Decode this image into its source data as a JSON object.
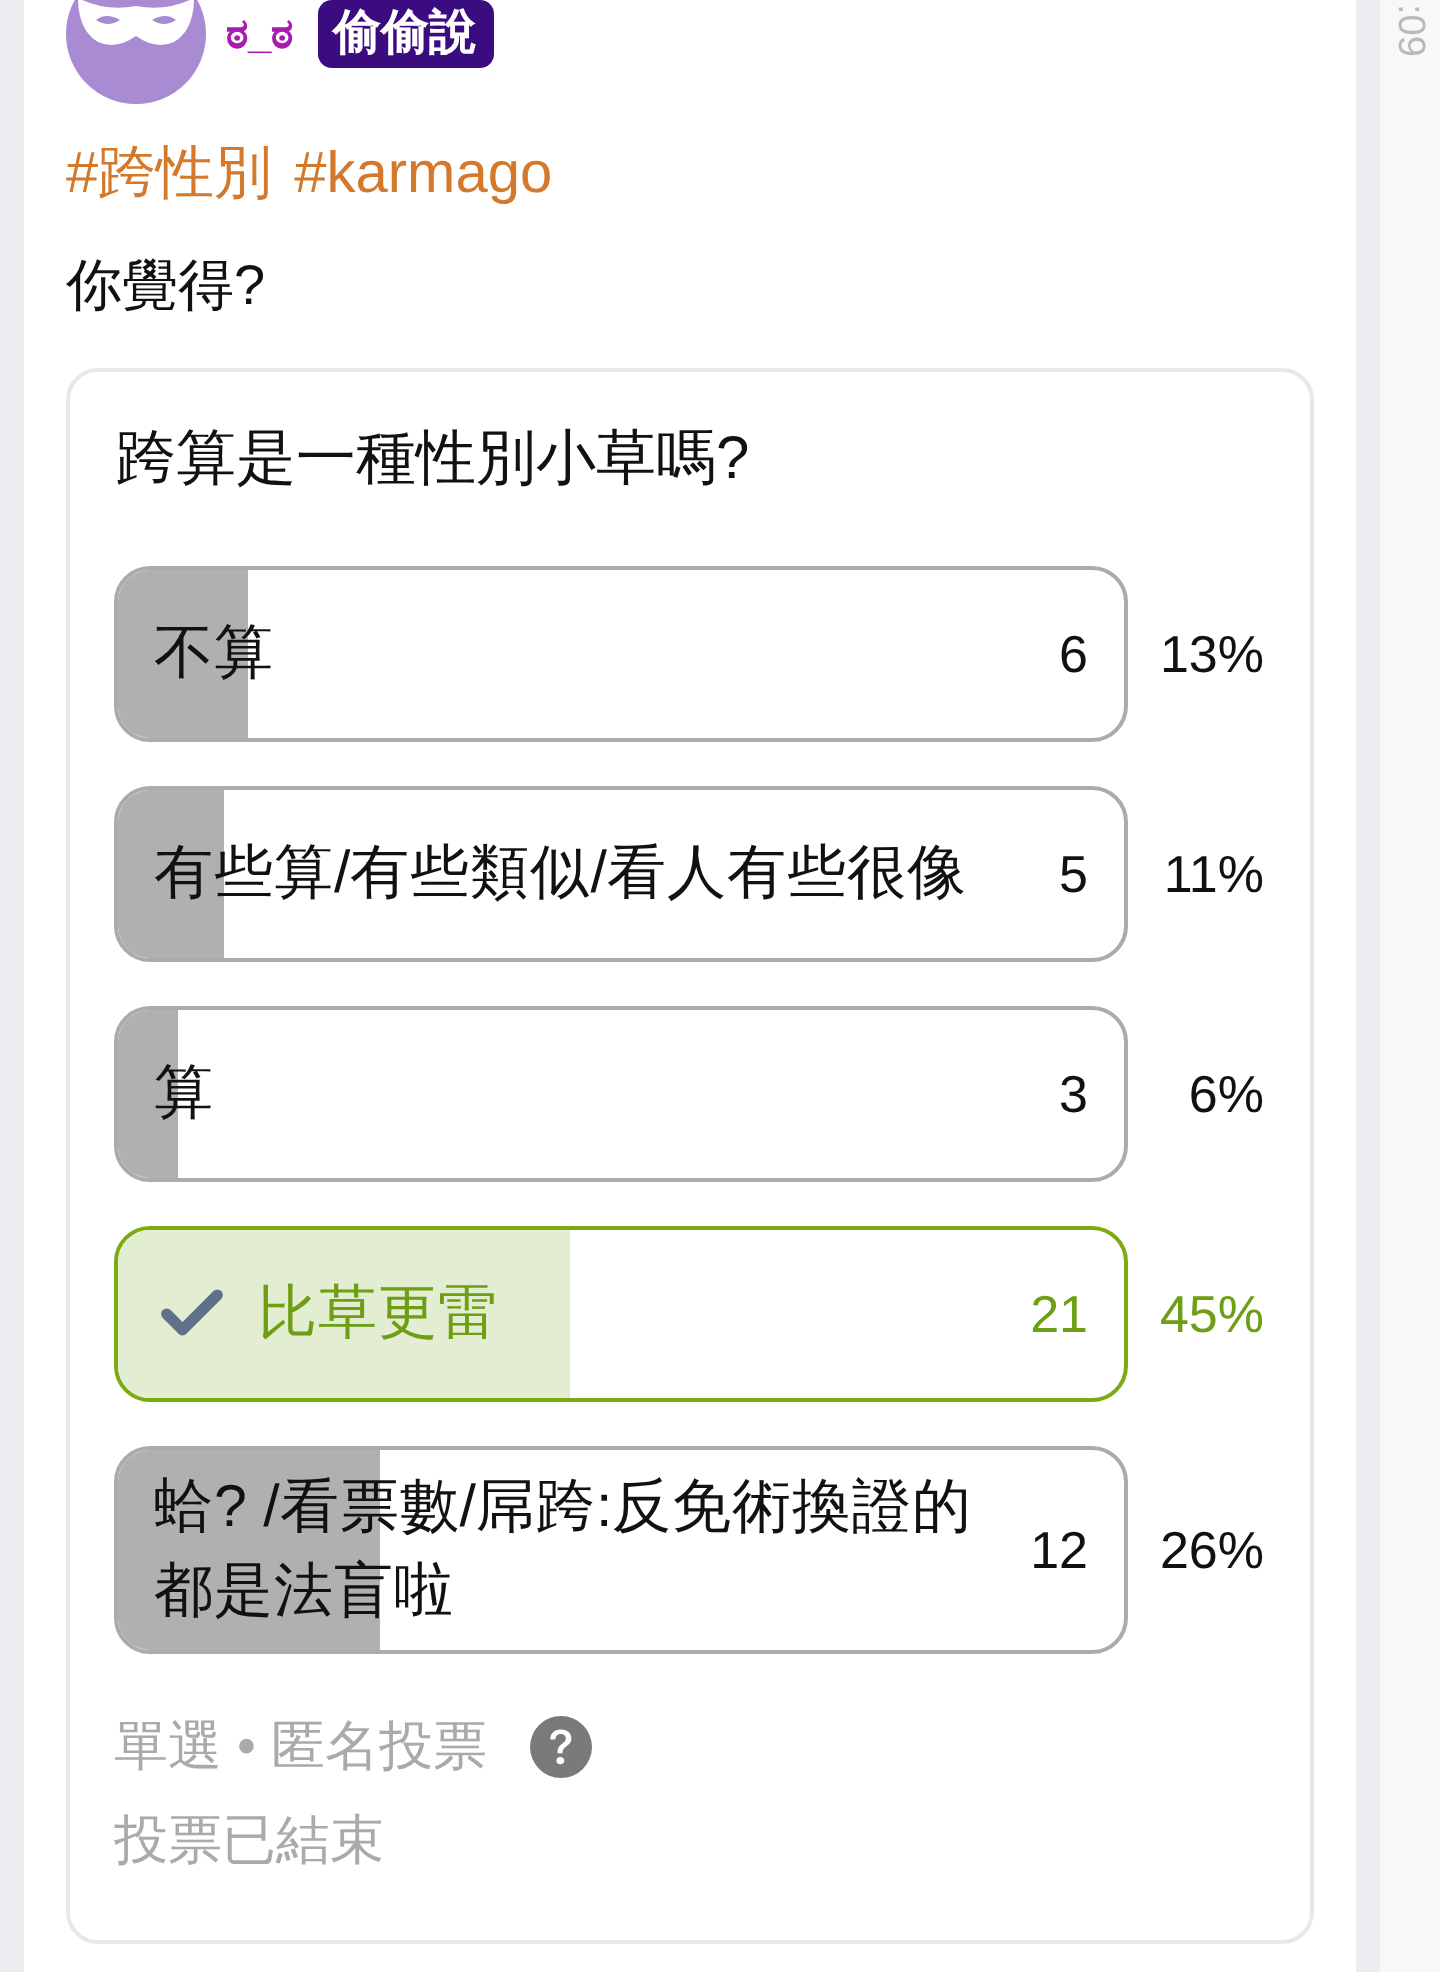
{
  "post": {
    "author": {
      "name": "ಠ_ಠ",
      "badge": "偷偷說"
    },
    "tags": [
      "#跨性別",
      "#karmago"
    ],
    "text": "你覺得?"
  },
  "poll": {
    "question": "跨算是一種性別小草嗎?",
    "options": [
      {
        "label": "不算",
        "count": "6",
        "percent": "13%",
        "level": 0.13,
        "selected": false
      },
      {
        "label": "有些算/有些類似/看人有些很像",
        "count": "5",
        "percent": "11%",
        "level": 0.105,
        "selected": false
      },
      {
        "label": "算",
        "count": "3",
        "percent": "6%",
        "level": 0.06,
        "selected": false
      },
      {
        "label": "比草更雷",
        "count": "21",
        "percent": "45%",
        "level": 0.45,
        "selected": true
      },
      {
        "label": "蛤? /看票數/屌跨:反免術換證的都是法盲啦",
        "count": "12",
        "percent": "26%",
        "level": 0.26,
        "selected": false
      }
    ],
    "mode": "單選 • 匿名投票",
    "status": "投票已結束"
  },
  "side_strip": {
    "time": ":09"
  }
}
